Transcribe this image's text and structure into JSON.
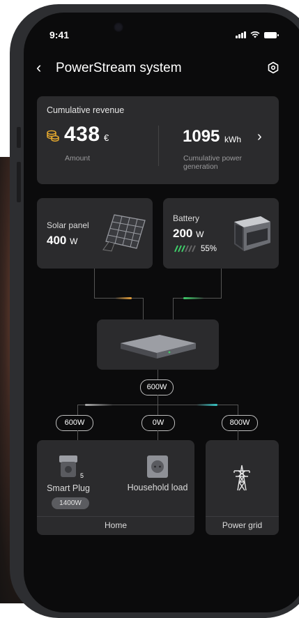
{
  "status_bar": {
    "time": "9:41"
  },
  "header": {
    "title": "PowerStream system"
  },
  "revenue": {
    "title": "Cumulative revenue",
    "amount": "438",
    "amount_unit": "€",
    "amount_label": "Amount",
    "generation": "1095",
    "generation_unit": "kWh",
    "generation_label": "Cumulative power generation"
  },
  "solar": {
    "label": "Solar panel",
    "power": "400",
    "unit": "W"
  },
  "battery": {
    "label": "Battery",
    "power": "200",
    "unit": "W",
    "level": "55%",
    "level_fraction": 0.55
  },
  "flow": {
    "inverter_output": "600W",
    "left_output": "600W",
    "middle_output": "0W",
    "right_output": "800W"
  },
  "home": {
    "label": "Home",
    "smart_plug": {
      "label": "Smart Plug",
      "count": "5",
      "power": "1400W"
    },
    "household": {
      "label": "Household load"
    }
  },
  "grid": {
    "label": "Power grid"
  },
  "colors": {
    "solar_flow": "#e8a13a",
    "battery_flow": "#3fce6a",
    "grid_flow": "#38c6c6",
    "card_bg": "#2b2b2d"
  }
}
